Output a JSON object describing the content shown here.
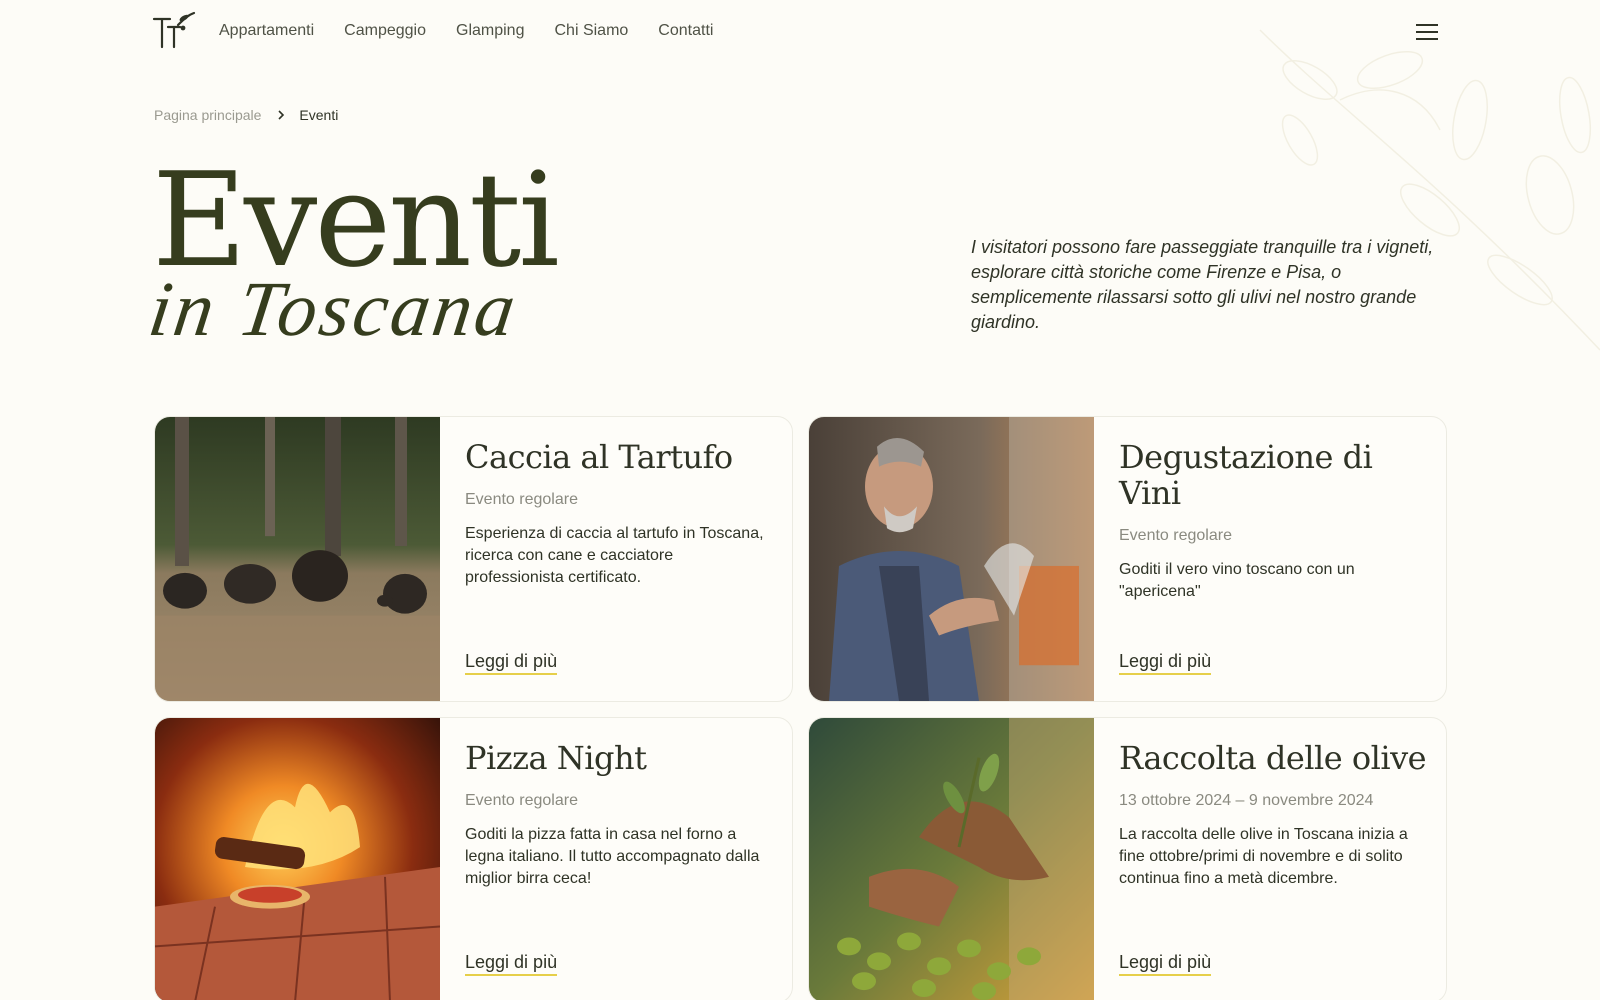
{
  "header": {
    "logo": "TT",
    "nav": [
      "Appartamenti",
      "Campeggio",
      "Glamping",
      "Chi Siamo",
      "Contatti"
    ],
    "menu_icon": "hamburger-menu-icon"
  },
  "breadcrumb": {
    "home": "Pagina principale",
    "separator_icon": "chevron-right-icon",
    "current": "Eventi"
  },
  "hero": {
    "title": "Eventi",
    "subtitle": "in Toscana",
    "intro": "I visitatori possono fare passeggiate tranquille tra i vigneti, esplorare città storiche come Firenze e Pisa, o semplicemente rilassarsi sotto gli ulivi nel nostro grande giardino."
  },
  "events": [
    {
      "title": "Caccia al Tartufo",
      "meta": "Evento regolare",
      "description": "Esperienza di caccia al tartufo in Toscana, ricerca con cane e cacciatore professionista certificato.",
      "link": "Leggi di più",
      "image": "wild-boars-in-forest"
    },
    {
      "title": "Degustazione di Vini",
      "meta": "Evento regolare",
      "description": "Goditi il vero vino toscano con un \"apericena\"",
      "link": "Leggi di più",
      "image": "man-with-wine-glass"
    },
    {
      "title": "Pizza Night",
      "meta": "Evento regolare",
      "description": "Goditi la pizza fatta in casa nel forno a legna italiano. Il tutto accompagnato dalla miglior birra ceca!",
      "link": "Leggi di più",
      "image": "pizza-in-wood-oven"
    },
    {
      "title": "Raccolta delle olive",
      "meta": "13 ottobre 2024 – 9 novembre 2024",
      "description": "La raccolta delle olive in Toscana inizia a fine ottobre/primi di novembre e di solito continua fino a metà dicembre.",
      "link": "Leggi di più",
      "image": "hands-harvesting-olives"
    }
  ],
  "colors": {
    "background": "#fdfcf7",
    "heading": "#363d1e",
    "link_underline": "#e6cf4a",
    "muted": "#8a8a80"
  }
}
